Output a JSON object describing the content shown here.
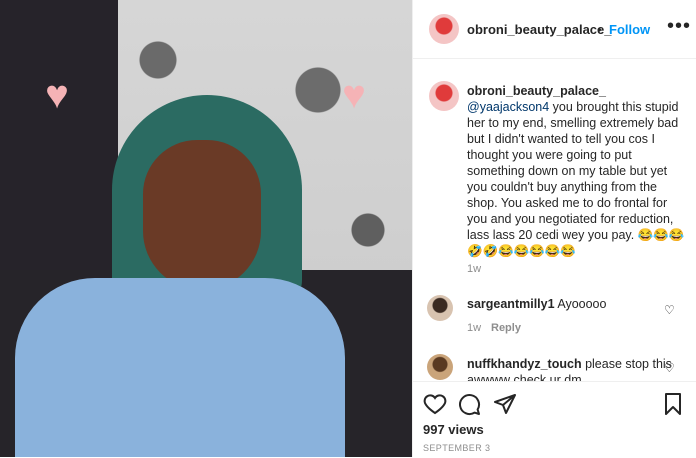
{
  "post": {
    "username": "obroni_beauty_palace_",
    "separator": "•",
    "follow_label": "Follow",
    "more_label": "•••"
  },
  "caption": {
    "username": "obroni_beauty_palace_",
    "mention": "@yaajackson4",
    "text": " you brought this stupid her to my end, smelling extremely bad but I didn't wanted to tell you cos I thought you were going to put something down on my table but yet you couldn't buy anything from the shop. You asked me to do frontal for you and you negotiated for reduction, lass lass 20 cedi wey you pay. 😂😂😂🤣🤣😂😂😂😂😂",
    "time": "1w"
  },
  "comments": [
    {
      "username": "sargeantmilly1",
      "text": " Ayooooo",
      "time": "1w",
      "reply_label": "Reply"
    },
    {
      "username": "nuffkhandyz_touch",
      "text": " please stop this awwww check ur dm",
      "time": "",
      "reply_label": ""
    }
  ],
  "stats": {
    "views": "997 views",
    "date": "SEPTEMBER 3"
  },
  "icons": {
    "decoration": "heart-sticker",
    "like": "heart-outline-icon",
    "comment": "comment-icon",
    "share": "paper-plane-icon",
    "save": "bookmark-icon"
  },
  "colors": {
    "accent": "#0095f6",
    "muted": "#8e8e8e",
    "heart_sticker": "#f5b3b6"
  }
}
